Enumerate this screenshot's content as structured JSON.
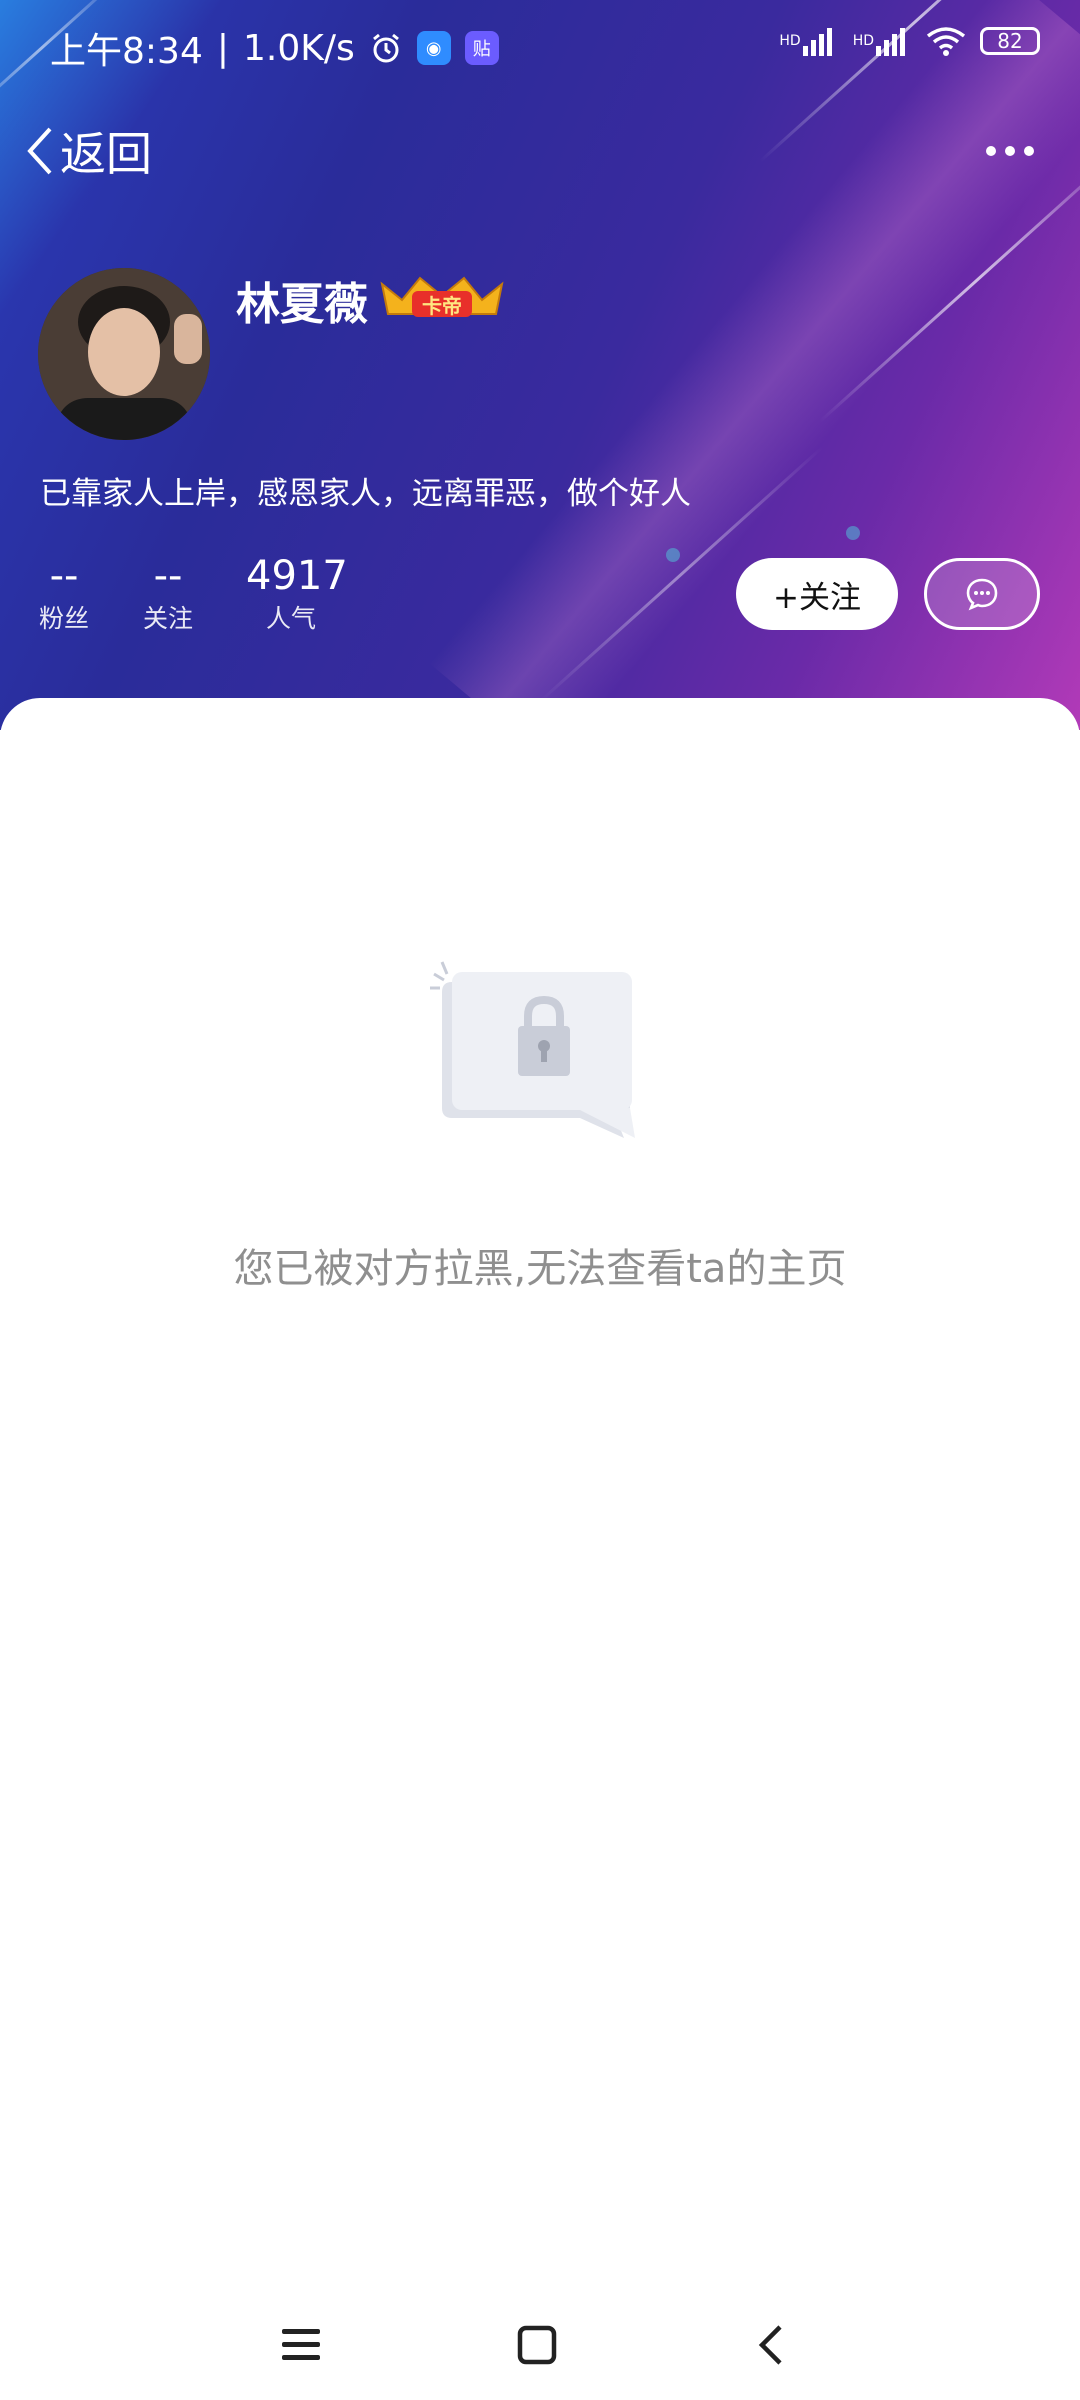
{
  "status_bar": {
    "time": "上午8:34",
    "separator": "|",
    "speed": "1.0K/s",
    "app_badge_1": "◉",
    "app_badge_2": "贴",
    "hd_1": "HD",
    "hd_2": "HD",
    "battery": "82"
  },
  "nav": {
    "back_label": "返回"
  },
  "profile": {
    "name": "林夏薇",
    "badge_text": "卡帝",
    "bio": "已靠家人上岸，感恩家人，远离罪恶，做个好人",
    "stats": [
      {
        "value": "--",
        "label": "粉丝"
      },
      {
        "value": "--",
        "label": "关注"
      },
      {
        "value": "4917",
        "label": "人气"
      }
    ],
    "follow_label": "+关注"
  },
  "content": {
    "blocked_message": "您已被对方拉黑,无法查看ta的主页"
  },
  "colors": {
    "header_start": "#2a3bb8",
    "header_end": "#b23ab8",
    "muted_text": "#8f8f8f",
    "badge_red": "#e8302a"
  }
}
